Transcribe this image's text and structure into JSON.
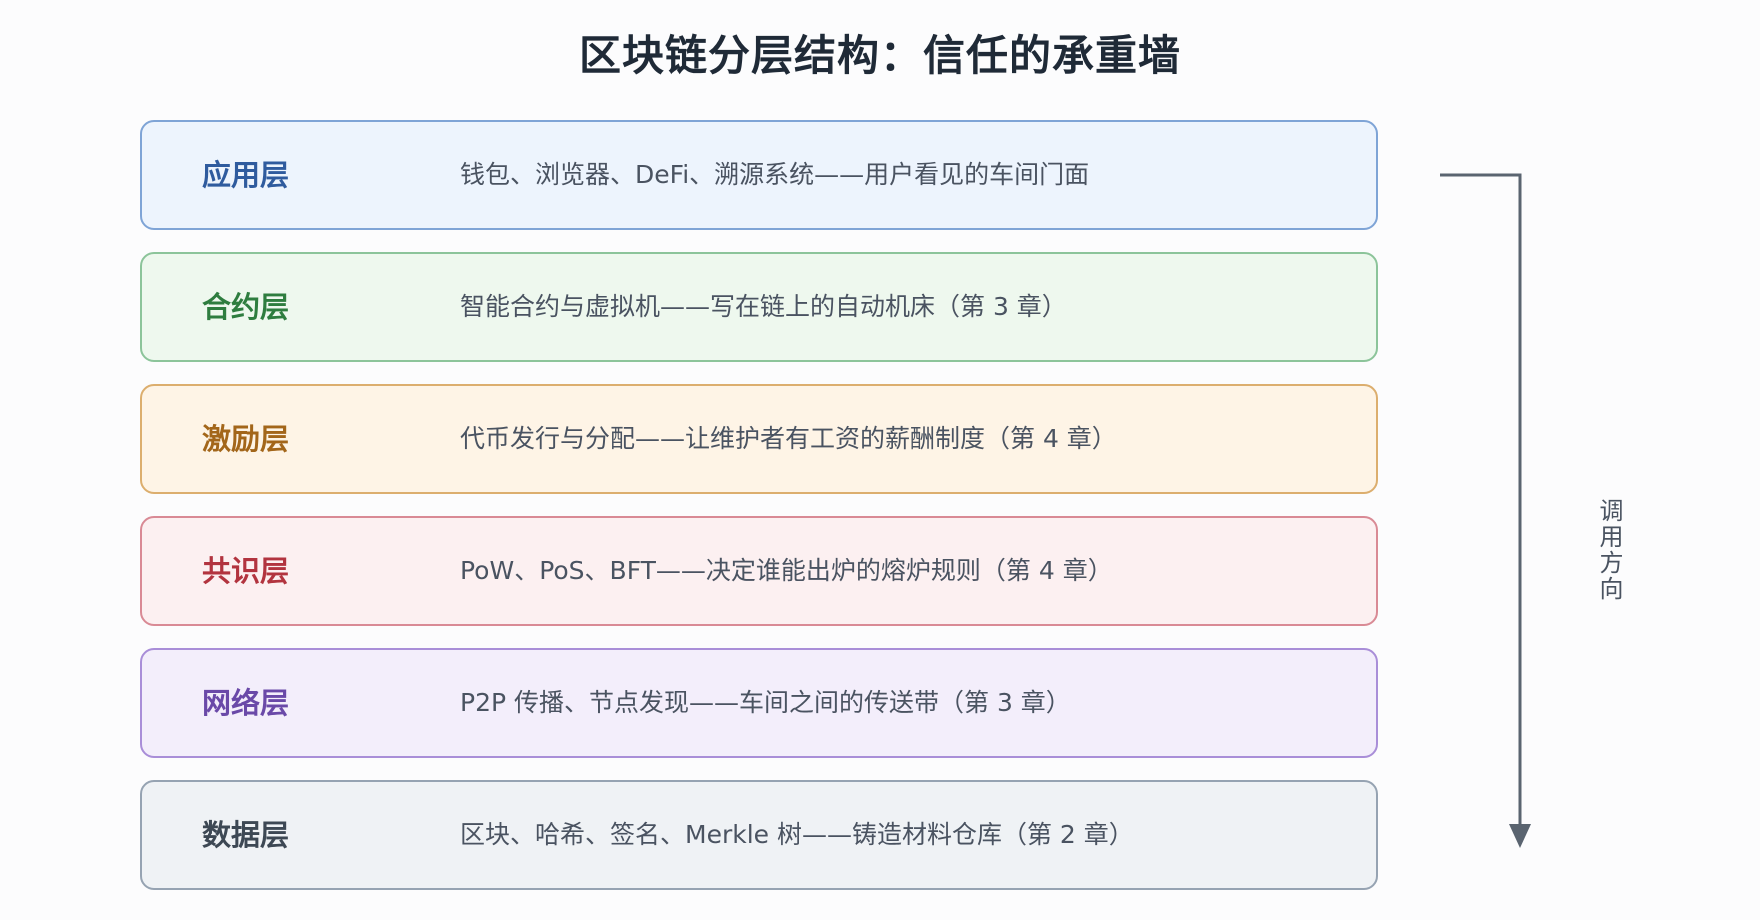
{
  "title": "区块链分层结构：信任的承重墙",
  "layers": [
    {
      "name": "应用层",
      "desc": "钱包、浏览器、DeFi、溯源系统——用户看见的车间门面",
      "colors": {
        "bg": "#edf4fd",
        "border": "#7fa4d6",
        "text": "#2f5b9e"
      }
    },
    {
      "name": "合约层",
      "desc": "智能合约与虚拟机——写在链上的自动机床（第 3 章）",
      "colors": {
        "bg": "#eef8ee",
        "border": "#8cc49a",
        "text": "#2e7d3f"
      }
    },
    {
      "name": "激励层",
      "desc": "代币发行与分配——让维护者有工资的薪酬制度（第 4 章）",
      "colors": {
        "bg": "#fef4e6",
        "border": "#dcae6e",
        "text": "#a3661a"
      }
    },
    {
      "name": "共识层",
      "desc": "PoW、PoS、BFT——决定谁能出炉的熔炉规则（第 4 章）",
      "colors": {
        "bg": "#fcf0f1",
        "border": "#d98a95",
        "text": "#b2343f"
      }
    },
    {
      "name": "网络层",
      "desc": "P2P 传播、节点发现——车间之间的传送带（第 3 章）",
      "colors": {
        "bg": "#f3eefb",
        "border": "#a98ed8",
        "text": "#6a49a8"
      }
    },
    {
      "name": "数据层",
      "desc": "区块、哈希、签名、Merkle 树——铸造材料仓库（第 2 章）",
      "colors": {
        "bg": "#eff2f5",
        "border": "#96a3b2",
        "text": "#3d4854"
      }
    }
  ],
  "flow": {
    "label": "调用方向",
    "color": "#5a6470"
  }
}
